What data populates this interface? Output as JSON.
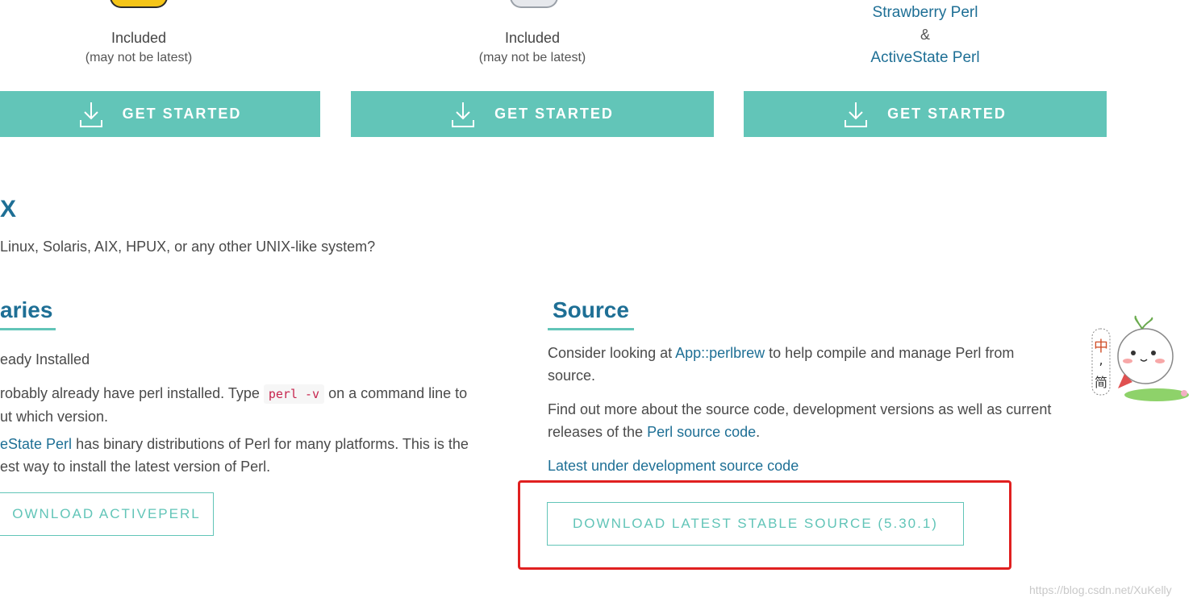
{
  "platforms": [
    {
      "included": "Included",
      "note": "(may not be latest)",
      "button_label": "GET STARTED"
    },
    {
      "included": "Included",
      "note": "(may not be latest)",
      "button_label": "GET STARTED"
    },
    {
      "link1": "Strawberry Perl",
      "amp": "&",
      "link2": "ActiveState Perl",
      "button_label": "GET STARTED"
    }
  ],
  "unix": {
    "heading": "X",
    "description": "Linux, Solaris, AIX, HPUX, or any other UNIX-like system?"
  },
  "binaries": {
    "heading": "aries",
    "subheading": "eady Installed",
    "para1_before": "robably already have perl installed. Type ",
    "para1_code": "perl -v",
    "para1_after": " on a command line to",
    "para1_line2": "ut which version.",
    "para2_link": "eState Perl",
    "para2_text": " has binary distributions of Perl for many platforms. This is the",
    "para2_line2": "est way to install the latest version of Perl.",
    "button_label": "OWNLOAD ACTIVEPERL"
  },
  "source": {
    "heading": "Source",
    "para1_before": "Consider looking at ",
    "para1_link": "App::perlbrew",
    "para1_after": " to help compile and manage Perl from",
    "para1_line2": "source.",
    "para2_line1": "Find out more about the source code, development versions as well as current",
    "para2_before": "releases of the ",
    "para2_link": "Perl source code",
    "para2_after": ".",
    "dev_link": "Latest under development source code",
    "button_label": "DOWNLOAD LATEST STABLE SOURCE (5.30.1)"
  },
  "sticker": {
    "char1": "中",
    "char2": "简"
  },
  "watermark": "https://blog.csdn.net/XuKelly",
  "colors": {
    "accent": "#62c5b8",
    "link": "#1e6f95",
    "highlight_box": "#e02020"
  }
}
